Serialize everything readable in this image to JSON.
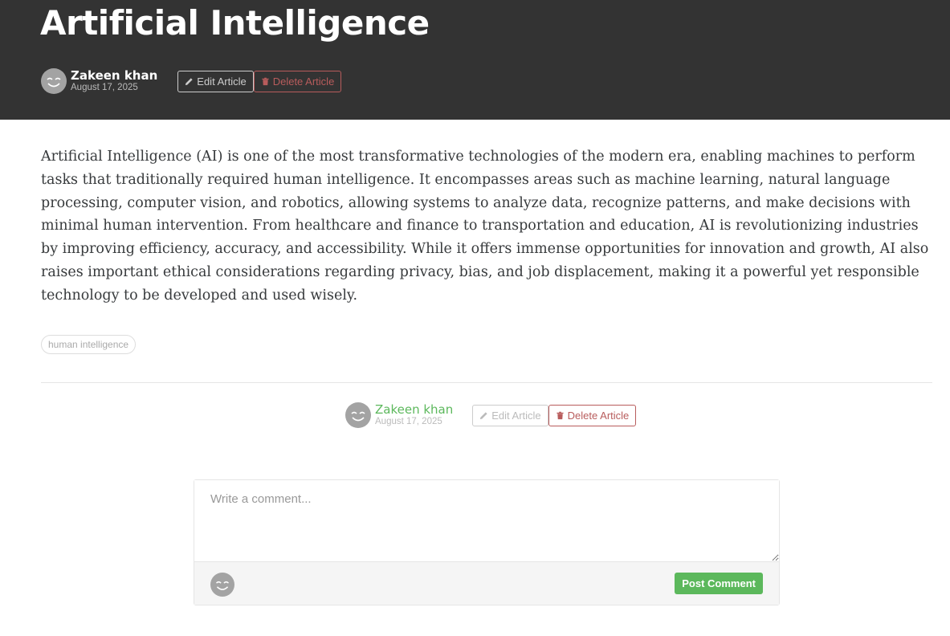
{
  "article": {
    "title": "Artificial Intelligence",
    "author": "Zakeen khan",
    "date": "August 17, 2025",
    "body": "Artificial Intelligence (AI) is one of the most transformative technologies of the modern era, enabling machines to perform tasks that traditionally required human intelligence. It encompasses areas such as machine learning, natural language processing, computer vision, and robotics, allowing systems to analyze data, recognize patterns, and make decisions with minimal human intervention. From healthcare and finance to transportation and education, AI is revolutionizing industries by improving efficiency, accuracy, and accessibility. While it offers immense opportunities for innovation and growth, AI also raises important ethical considerations regarding privacy, bias, and job displacement, making it a powerful yet responsible technology to be developed and used wisely.",
    "tags": [
      "human intelligence"
    ]
  },
  "actions": {
    "edit_label": "Edit Article",
    "delete_label": "Delete Article"
  },
  "comment": {
    "placeholder": "Write a comment...",
    "post_label": "Post Comment"
  },
  "icons": {
    "avatar": "smiley-avatar-icon",
    "edit": "pencil-icon",
    "delete": "trash-icon"
  },
  "colors": {
    "banner": "#333333",
    "accent": "#5cb85c",
    "danger": "#b85c5c",
    "text": "#373a3c"
  }
}
